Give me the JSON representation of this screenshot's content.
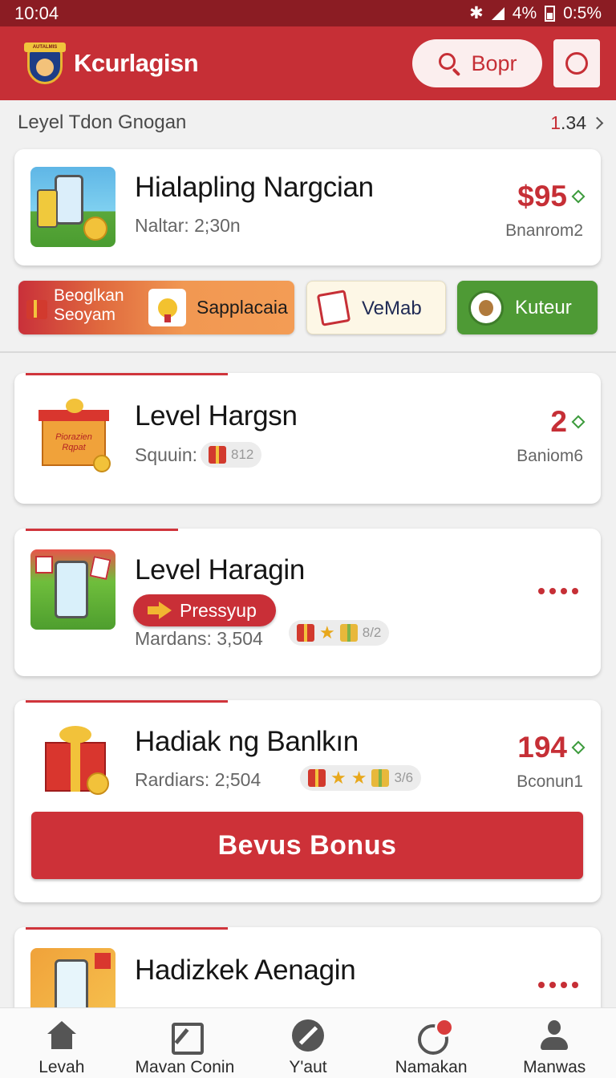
{
  "status": {
    "time": "10:04",
    "battery_pct": "4%",
    "speed": "0:5%"
  },
  "header": {
    "logo_text": "AUTALMIS",
    "title": "Kcurlagisn",
    "search_label": "Bopr"
  },
  "level": {
    "label": "Leyel Tdon Gnogan",
    "link_prefix": "1",
    "link_value": ".34"
  },
  "featured": {
    "title": "Hialapling Nargcian",
    "subtitle": "Naltar: 2;30n",
    "price": "$95",
    "price_sub": "Bnanrom2"
  },
  "shortcuts": [
    {
      "label_line1": "Beoglkan",
      "label_line2": "Seoyam",
      "text": "Sapplacaia"
    },
    {
      "text": "VeMab"
    },
    {
      "text": "Kuteur"
    }
  ],
  "cards": [
    {
      "title": "Level Hargsn",
      "subtitle": "Squuin:",
      "pill": "812",
      "price": "2",
      "price_sub": "Baniom6",
      "thumb_text": "Piorazien Rqpat"
    },
    {
      "title": "Level Haragin",
      "subtitle": "Mardans: 3,504",
      "pill": "8/2",
      "button": "Pressyup"
    },
    {
      "title": "Hadiak ng Banlkın",
      "subtitle": "Rardiars: 2;504",
      "pill": "3/6",
      "price": "194",
      "price_sub": "Bconun1",
      "button": "Bevus Bonus"
    },
    {
      "title": "Hadizkek Aenagin"
    }
  ],
  "nav": [
    {
      "label": "Levah",
      "icon": "home-icon"
    },
    {
      "label": "Mavan Conin",
      "icon": "edit-icon"
    },
    {
      "label": "Y'aut",
      "icon": "pen-icon"
    },
    {
      "label": "Namakan",
      "icon": "chat-icon"
    },
    {
      "label": "Manwas",
      "icon": "user-icon"
    }
  ],
  "colors": {
    "primary": "#c62f36",
    "status_bar": "#8b1c23",
    "accent_green": "#4e9a35",
    "background": "#f1f1f1"
  }
}
